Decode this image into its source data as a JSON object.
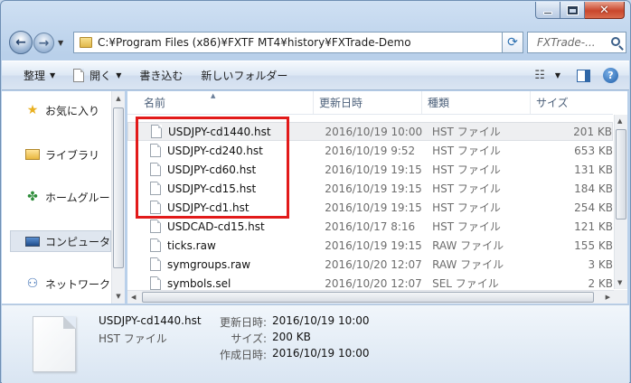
{
  "window": {
    "address_path": "C:¥Program Files (x86)¥FXTF MT4¥history¥FXTrade-Demo",
    "search_placeholder": "FXTrade-..."
  },
  "commands": {
    "organize": "整理",
    "open": "開く",
    "write": "書き込む",
    "new_folder": "新しいフォルダー"
  },
  "nav": {
    "favorites": "お気に入り",
    "libraries": "ライブラリ",
    "homegroup": "ホームグループ",
    "computer": "コンピューター",
    "network": "ネットワーク"
  },
  "columns": {
    "name": "名前",
    "date": "更新日時",
    "type": "種類",
    "size": "サイズ"
  },
  "files": [
    {
      "name": "USDJPY-cd1440.hst",
      "date": "2016/10/19 10:00",
      "type": "HST ファイル",
      "size": "201 KB"
    },
    {
      "name": "USDJPY-cd240.hst",
      "date": "2016/10/19 9:52",
      "type": "HST ファイル",
      "size": "653 KB"
    },
    {
      "name": "USDJPY-cd60.hst",
      "date": "2016/10/19 19:15",
      "type": "HST ファイル",
      "size": "131 KB"
    },
    {
      "name": "USDJPY-cd15.hst",
      "date": "2016/10/19 19:15",
      "type": "HST ファイル",
      "size": "184 KB"
    },
    {
      "name": "USDJPY-cd1.hst",
      "date": "2016/10/19 19:15",
      "type": "HST ファイル",
      "size": "254 KB"
    },
    {
      "name": "USDCAD-cd15.hst",
      "date": "2016/10/17 8:16",
      "type": "HST ファイル",
      "size": "121 KB"
    },
    {
      "name": "ticks.raw",
      "date": "2016/10/19 19:15",
      "type": "RAW ファイル",
      "size": "155 KB"
    },
    {
      "name": "symgroups.raw",
      "date": "2016/10/20 12:07",
      "type": "RAW ファイル",
      "size": "3 KB"
    },
    {
      "name": "symbols.sel",
      "date": "2016/10/20 12:07",
      "type": "SEL ファイル",
      "size": "2 KB"
    }
  ],
  "details": {
    "name": "USDJPY-cd1440.hst",
    "type": "HST ファイル",
    "modified_label": "更新日時:",
    "modified": "2016/10/19 10:00",
    "size_label": "サイズ:",
    "size": "200 KB",
    "created_label": "作成日時:",
    "created": "2016/10/19 10:00"
  },
  "colors": {
    "highlight": "#e21a1a"
  }
}
